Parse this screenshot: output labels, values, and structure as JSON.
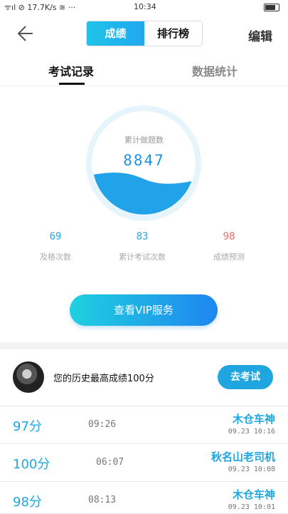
{
  "status_bar": {
    "left": "ᯤıl ⊘ 17.7K/s ≋ ···",
    "time": "10:34"
  },
  "header": {
    "tabs": [
      {
        "label": "成绩"
      },
      {
        "label": "排行榜"
      }
    ],
    "edit_label": "编辑"
  },
  "subtabs": [
    {
      "label": "考试记录"
    },
    {
      "label": "数据统计"
    }
  ],
  "summary": {
    "total_label": "累计做题数",
    "total_value": "8847",
    "metrics": [
      {
        "value": "69",
        "label": "及格次数",
        "color": "#21a7e0"
      },
      {
        "value": "83",
        "label": "累计考试次数",
        "color": "#21a7e0"
      },
      {
        "value": "98",
        "label": "成绩预测",
        "color": "#f06b6b"
      }
    ]
  },
  "vip_button": "查看VIP服务",
  "best": {
    "text": "您的历史最高成绩100分",
    "button": "去考试"
  },
  "records": [
    {
      "score": "97分",
      "duration": "09:26",
      "name": "木仓车神",
      "date": "09.23  10:16"
    },
    {
      "score": "100分",
      "duration": "06:07",
      "name": "秋名山老司机",
      "date": "09.23  10:08"
    },
    {
      "score": "98分",
      "duration": "08:13",
      "name": "木仓车神",
      "date": "09.23  10:01"
    }
  ]
}
